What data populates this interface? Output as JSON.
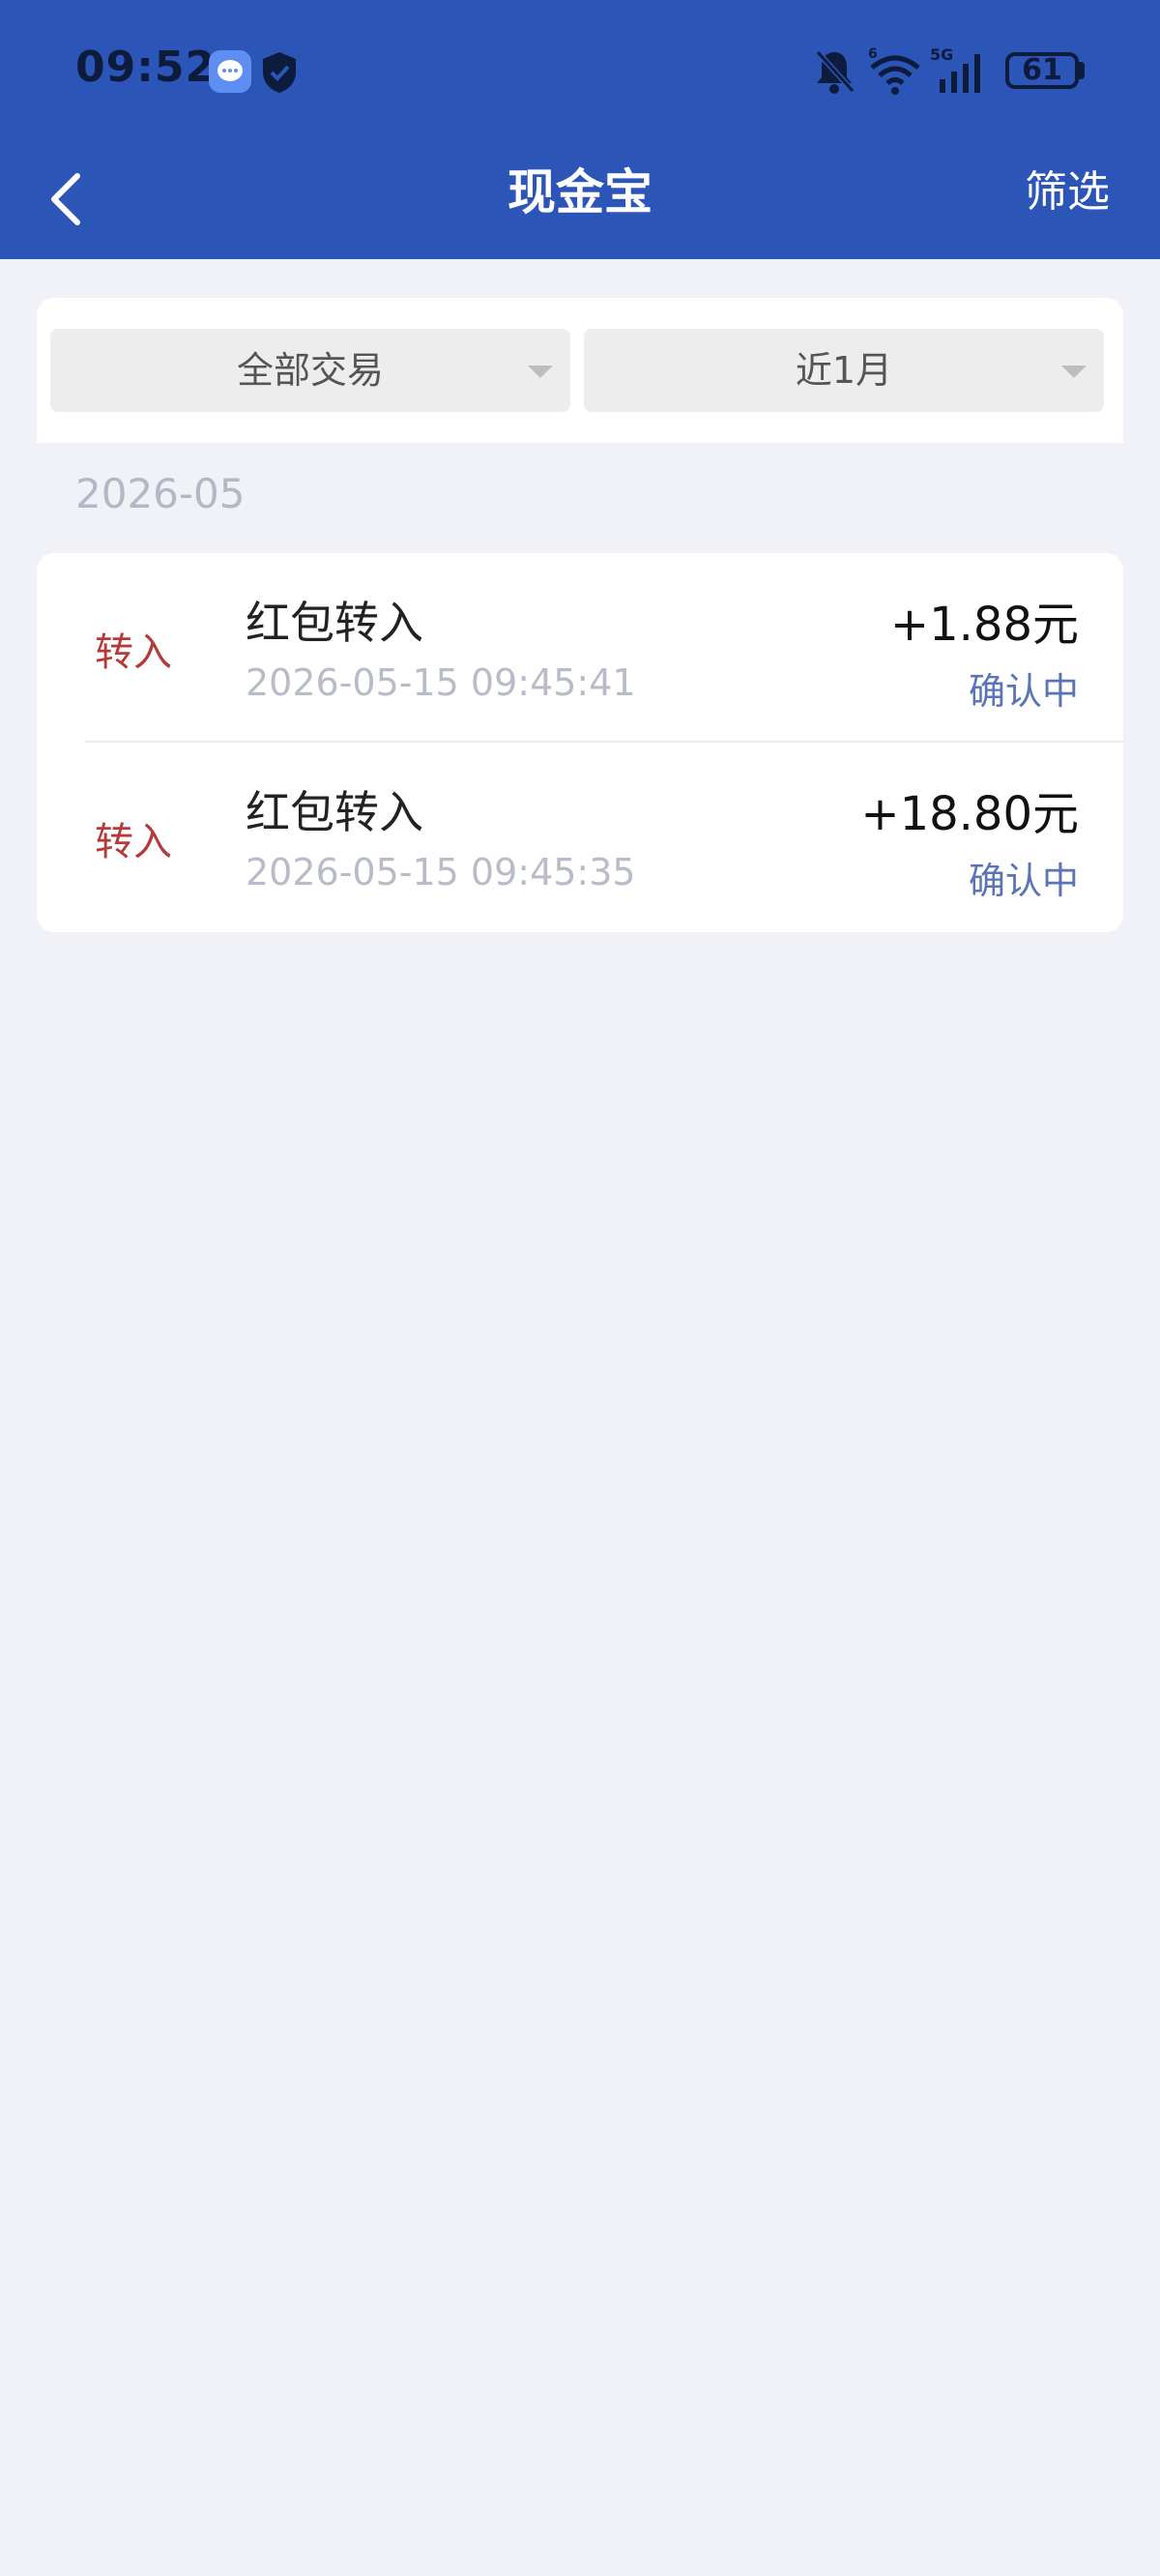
{
  "status_bar": {
    "time": "09:52",
    "battery": "61",
    "icons": [
      "message-icon",
      "shield-icon",
      "bell-muted-icon",
      "wifi-icon",
      "signal-5g-icon",
      "battery-icon"
    ]
  },
  "nav": {
    "title": "现金宝",
    "filter_label": "筛选",
    "back_icon": "chevron-left-icon"
  },
  "filters": {
    "type_label": "全部交易",
    "period_label": "近1月"
  },
  "month": "2026-05",
  "transactions": [
    {
      "type": "转入",
      "name": "红包转入",
      "time": "2026-05-15 09:45:41",
      "amount": "+1.88元",
      "status": "确认中"
    },
    {
      "type": "转入",
      "name": "红包转入",
      "time": "2026-05-15 09:45:35",
      "amount": "+18.80元",
      "status": "确认中"
    }
  ],
  "colors": {
    "header_bg": "#2c55b8",
    "page_bg": "#f0f2f7",
    "type_red": "#b53a3a",
    "status_blue": "#5a74b6"
  }
}
